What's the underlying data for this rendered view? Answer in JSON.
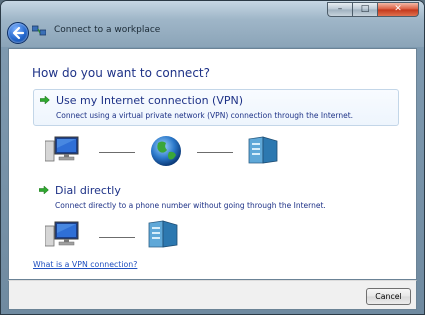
{
  "window": {
    "title": "Connect to a workplace",
    "caption_buttons": {
      "minimize": "–",
      "maximize": "□",
      "close": "✕"
    }
  },
  "main": {
    "heading": "How do you want to connect?",
    "options": [
      {
        "title": "Use my Internet connection (VPN)",
        "description": "Connect using a virtual private network (VPN) connection through the Internet."
      },
      {
        "title": "Dial directly",
        "description": "Connect directly to a phone number without going through the Internet."
      }
    ],
    "help_link": "What is a VPN connection?"
  },
  "footer": {
    "cancel_label": "Cancel"
  },
  "colors": {
    "heading_text": "#1e3287",
    "link": "#1f4fbf",
    "option_highlight_border": "#c3d6e8"
  },
  "icons": [
    "back-arrow-icon",
    "network-icon",
    "green-arrow-icon",
    "computer-icon",
    "globe-icon",
    "server-icon"
  ]
}
